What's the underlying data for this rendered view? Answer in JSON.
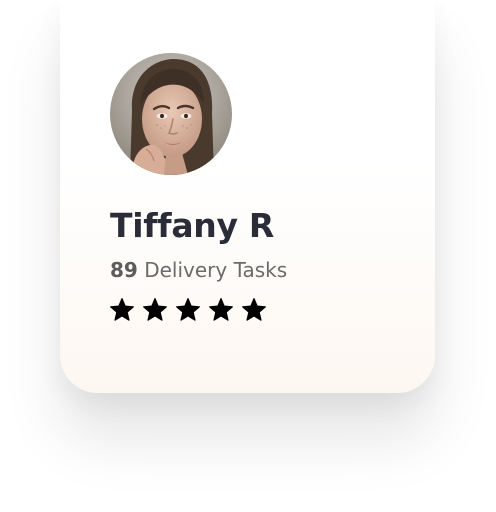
{
  "profile": {
    "name": "Tiffany R",
    "task_count": "89",
    "task_label": "Delivery Tasks",
    "rating": 5,
    "rating_max": 5
  },
  "icons": {
    "star": "star-icon",
    "avatar": "avatar-photo"
  },
  "colors": {
    "name_text": "#2a2c37",
    "secondary_text": "#6b6b6b",
    "star_fill": "#000000",
    "card_bottom": "#fdf7f1"
  }
}
